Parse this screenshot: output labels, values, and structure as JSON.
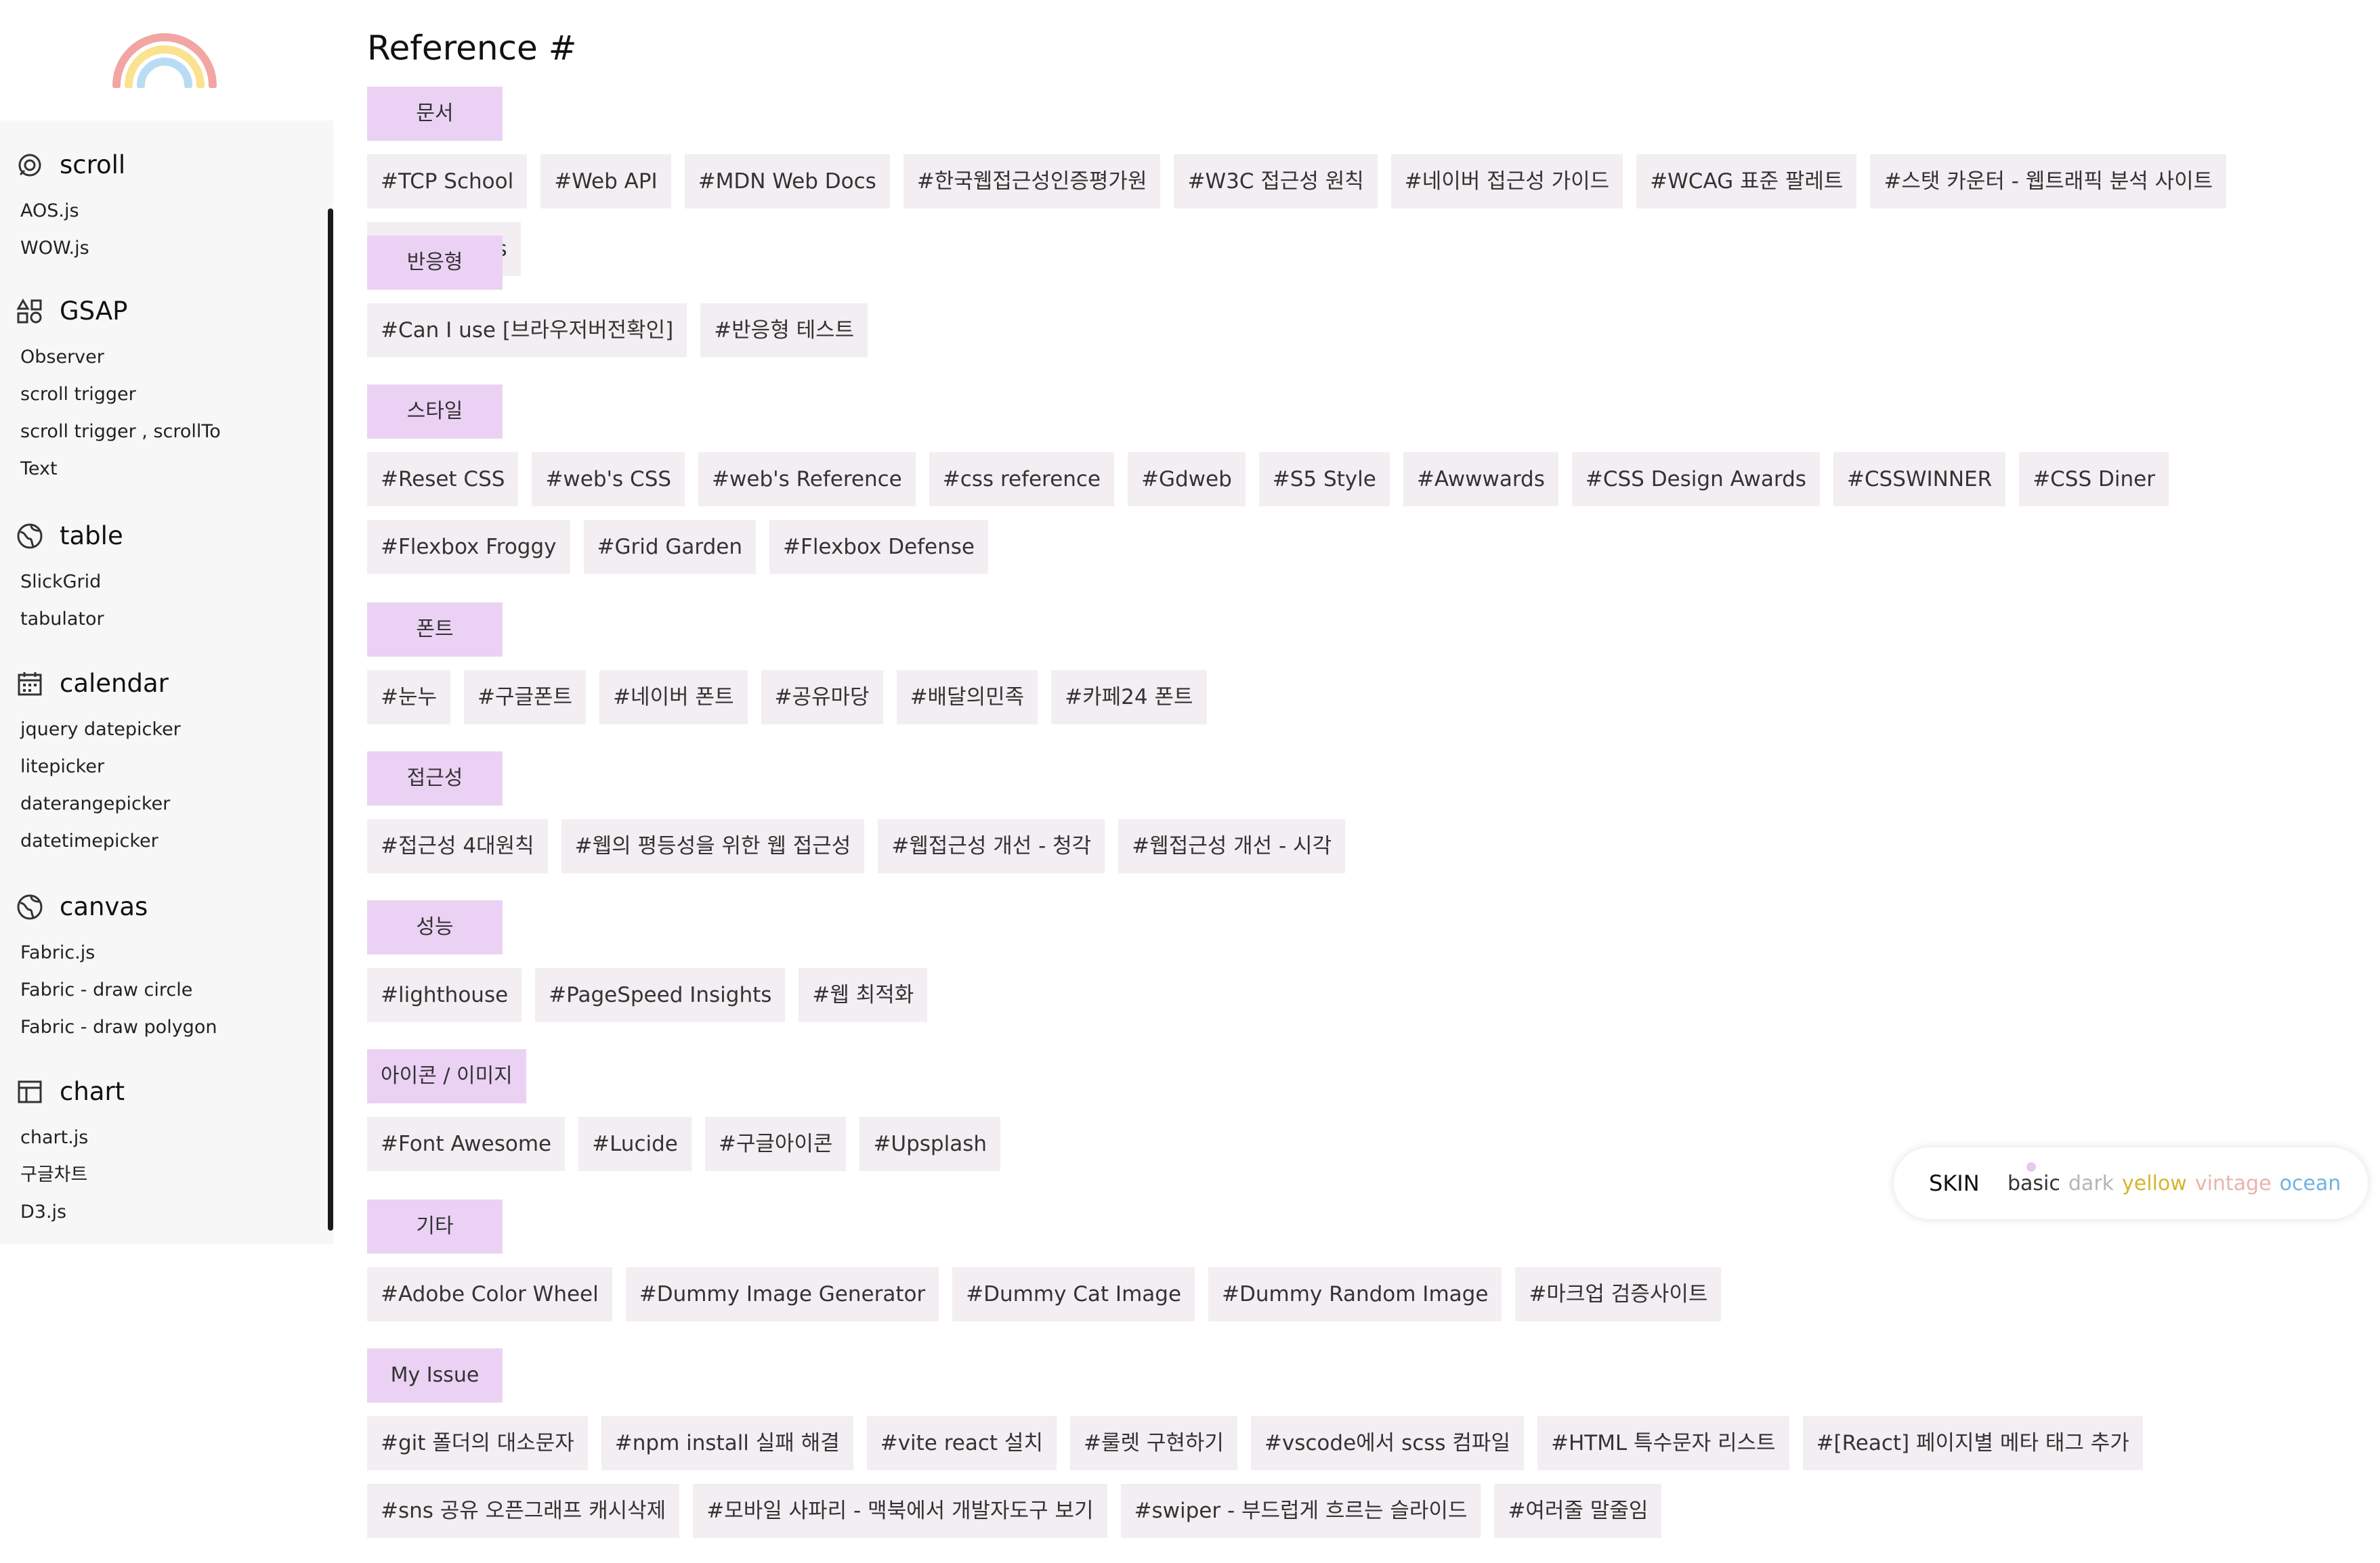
{
  "sidebar": {
    "groups": [
      {
        "icon": "scroll-icon",
        "title": "scroll",
        "items": [
          "AOS.js",
          "WOW.js"
        ]
      },
      {
        "icon": "shapes-icon",
        "title": "GSAP",
        "items": [
          "Observer",
          "scroll trigger",
          "scroll trigger , scrollTo",
          "Text"
        ]
      },
      {
        "icon": "globe-icon",
        "title": "table",
        "items": [
          "SlickGrid",
          "tabulator"
        ]
      },
      {
        "icon": "calendar-icon",
        "title": "calendar",
        "items": [
          "jquery datepicker",
          "litepicker",
          "daterangepicker",
          "datetimepicker"
        ]
      },
      {
        "icon": "globe-icon",
        "title": "canvas",
        "items": [
          "Fabric.js",
          "Fabric - draw circle",
          "Fabric - draw polygon"
        ]
      },
      {
        "icon": "table-icon",
        "title": "chart",
        "items": [
          "chart.js",
          "구글차트",
          "D3.js"
        ]
      }
    ]
  },
  "main": {
    "title": "Reference #",
    "sections": [
      {
        "category": "문서",
        "tags": [
          "#TCP School",
          "#Web API",
          "#MDN Web Docs",
          "#한국웹접근성인증평가원",
          "#W3C 접근성 원칙",
          "#네이버 접근성 가이드",
          "#WCAG 표준 팔레트",
          "#스탯 카운터 - 웹트래픽 분석 사이트",
          "#w3schools"
        ]
      },
      {
        "category": "반응형",
        "tags": [
          "#Can I use [브라우저버전확인]",
          "#반응형 테스트"
        ]
      },
      {
        "category": "스타일",
        "tags": [
          "#Reset CSS",
          "#web's CSS",
          "#web's Reference",
          "#css reference",
          "#Gdweb",
          "#S5 Style",
          "#Awwwards",
          "#CSS Design Awards",
          "#CSSWINNER",
          "#CSS Diner",
          "#Flexbox Froggy",
          "#Grid Garden",
          "#Flexbox Defense"
        ]
      },
      {
        "category": "폰트",
        "tags": [
          "#눈누",
          "#구글폰트",
          "#네이버 폰트",
          "#공유마당",
          "#배달의민족",
          "#카페24 폰트"
        ]
      },
      {
        "category": "접근성",
        "tags": [
          "#접근성 4대원칙",
          "#웹의 평등성을 위한 웹 접근성",
          "#웹접근성 개선 - 청각",
          "#웹접근성 개선 - 시각"
        ]
      },
      {
        "category": "성능",
        "tags": [
          "#lighthouse",
          "#PageSpeed Insights",
          "#웹 최적화"
        ]
      },
      {
        "category": "아이콘 / 이미지",
        "tags": [
          "#Font Awesome",
          "#Lucide",
          "#구글아이콘",
          "#Upsplash"
        ]
      },
      {
        "category": "기타",
        "tags": [
          "#Adobe Color Wheel",
          "#Dummy Image Generator",
          "#Dummy Cat Image",
          "#Dummy Random Image",
          "#마크업 검증사이트"
        ]
      },
      {
        "category": "My Issue",
        "tags": [
          "#git 폴더의 대소문자",
          "#npm install 실패 해결",
          "#vite react 설치",
          "#룰렛 구현하기",
          "#vscode에서 scss 컴파일",
          "#HTML 특수문자 리스트",
          "#[React] 페이지별 메타 태그 추가",
          "#sns 공유 오픈그래프 캐시삭제",
          "#모바일 사파리 - 맥북에서 개발자도구 보기",
          "#swiper - 부드럽게 흐르는 슬라이드",
          "#여러줄 말줄임"
        ]
      }
    ]
  },
  "skin": {
    "label": "SKIN",
    "options": [
      {
        "name": "basic",
        "color": "#333333"
      },
      {
        "name": "dark",
        "color": "#b5b5b5"
      },
      {
        "name": "yellow",
        "color": "#d4b62a"
      },
      {
        "name": "vintage",
        "color": "#e8b4a8"
      },
      {
        "name": "ocean",
        "color": "#6fb3e0"
      }
    ]
  },
  "colors": {
    "category_bg": "#ebd2f4",
    "tag_bg": "#f3eef2",
    "sidebar_bg": "#f7f7f7"
  }
}
